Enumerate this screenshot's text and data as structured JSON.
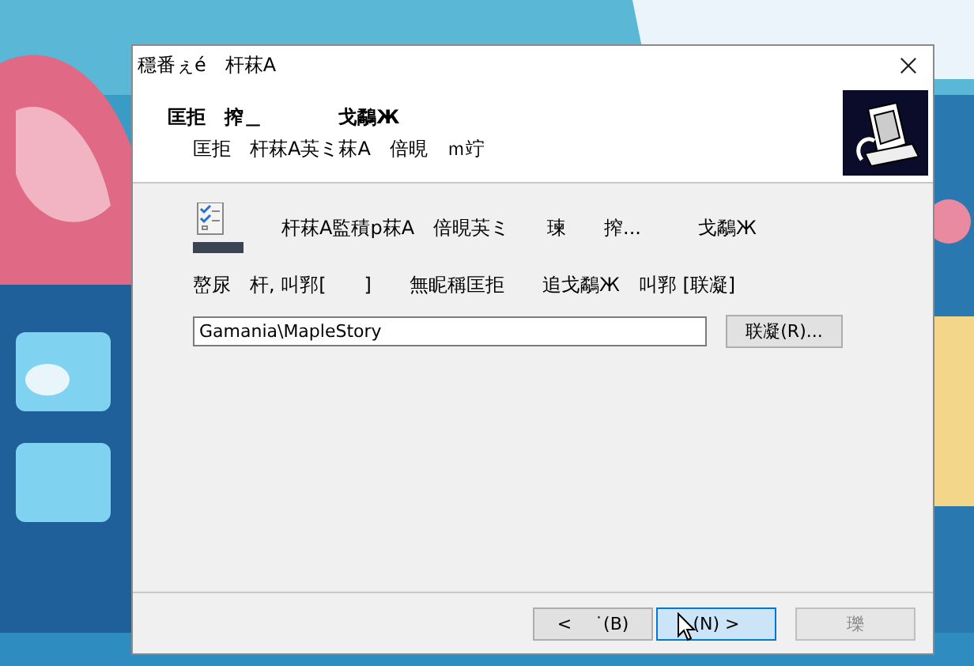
{
  "window": {
    "title": "穩番ぇé　杆菻A"
  },
  "header": {
    "title": "匡拒　搾＿　　　　戈鷸Ж",
    "subtitle": "匡拒　杆菻A芵ミ菻A　倍晛　ｍ竚"
  },
  "body": {
    "intro": "杆菻A監積p菻A　倍晛芵ミ　　瑓　　搾...　　　戈鷸Ж",
    "instruction": "嶅尿　杆, 叫郛[　　]　　無眤稱匡拒　　追戈鷸Ж　叫郛 [联凝]",
    "folder": {
      "value": "Gamania\\MapleStory"
    },
    "browse_button": "联凝(R)..."
  },
  "buttons": [
    {
      "label": "<　 ˙(B)",
      "highlighted": false,
      "disabled": false
    },
    {
      "label": "(N) >",
      "highlighted": true,
      "disabled": false
    },
    {
      "label": "瓅",
      "highlighted": false,
      "disabled": true
    }
  ]
}
